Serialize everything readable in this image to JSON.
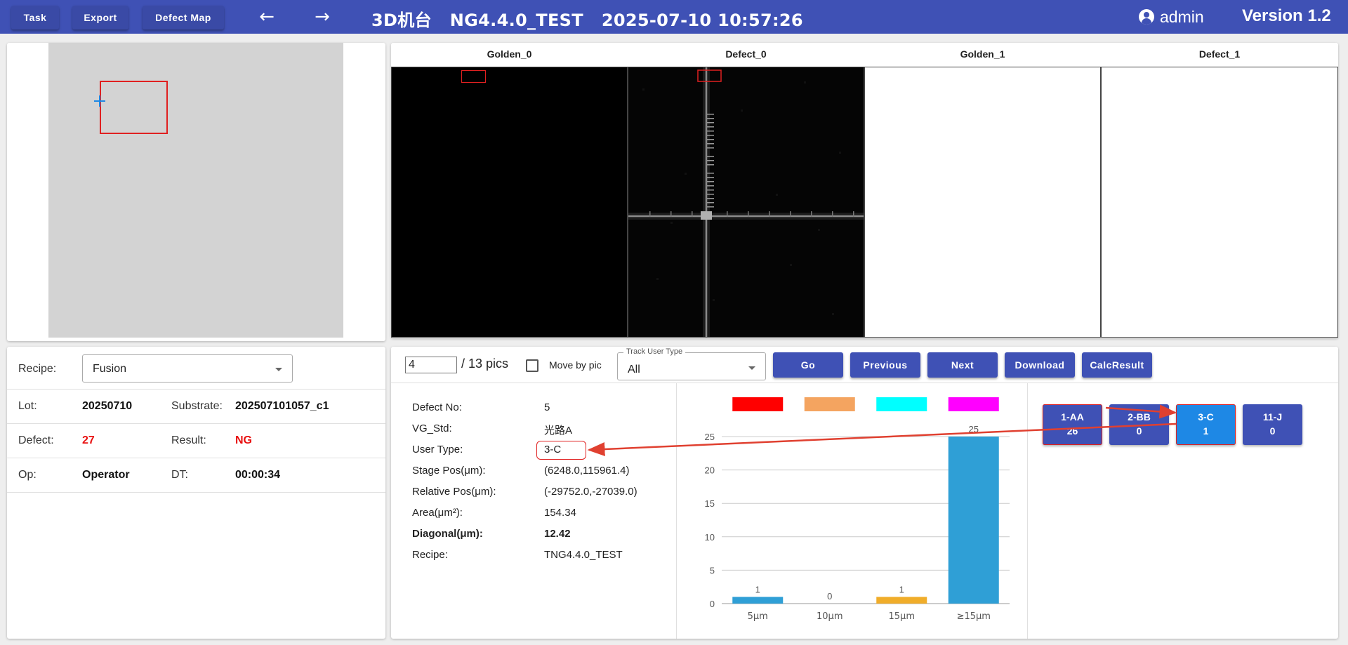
{
  "header": {
    "task_label": "Task",
    "export_label": "Export",
    "defect_map_label": "Defect Map",
    "back_icon": "arrow-left-icon",
    "forward_icon": "arrow-right-icon",
    "title": "3D机台   NG4.4.0_TEST   2025-07-10 10:57:26",
    "user": "admin",
    "version": "Version 1.2",
    "bar_color": "#3f51b5"
  },
  "images": {
    "headers": [
      "Golden_0",
      "Defect_0",
      "Golden_1",
      "Defect_1"
    ]
  },
  "info": {
    "recipe_label": "Recipe:",
    "recipe_value": "Fusion",
    "lot_label": "Lot:",
    "lot_value": "20250710",
    "substrate_label": "Substrate:",
    "substrate_value": "202507101057_c1",
    "defect_label": "Defect:",
    "defect_value": "27",
    "result_label": "Result:",
    "result_value": "NG",
    "op_label": "Op:",
    "op_value": "Operator",
    "dt_label": "DT:",
    "dt_value": "00:00:34"
  },
  "toolbar": {
    "page_value": "4",
    "page_total": "/ 13 pics",
    "move_by_pic_label": "Move by pic",
    "move_by_pic_checked": false,
    "track_user_type_label": "Track User Type",
    "track_user_type_value": "All",
    "go_label": "Go",
    "previous_label": "Previous",
    "next_label": "Next",
    "download_label": "Download",
    "calc_result_label": "CalcResult"
  },
  "details": {
    "defect_no_label": "Defect No:",
    "defect_no_value": "5",
    "vg_std_label": "VG_Std:",
    "vg_std_value": "光路A",
    "user_type_label": "User Type:",
    "user_type_value": "3-C",
    "stage_pos_label": "Stage Pos(μm):",
    "stage_pos_value": "(6248.0,115961.4)",
    "relative_pos_label": "Relative Pos(μm):",
    "relative_pos_value": "(-29752.0,-27039.0)",
    "area_label": "Area(μm²):",
    "area_value": "154.34",
    "diagonal_label": "Diagonal(μm):",
    "diagonal_value": "12.42",
    "recipe_label": "Recipe:",
    "recipe_value": "TNG4.4.0_TEST"
  },
  "chart_data": {
    "type": "bar",
    "categories": [
      "5μm",
      "10μm",
      "15μm",
      "≥15μm"
    ],
    "values": [
      1,
      0,
      1,
      25
    ],
    "bar_colors": [
      "#2f9fd6",
      "#2f9fd6",
      "#f0ad2a",
      "#2f9fd6"
    ],
    "legend_swatches": [
      "#ff0000",
      "#f4a460",
      "#00ffff",
      "#ff00ff"
    ],
    "ylim": [
      0,
      25
    ],
    "yticks": [
      0,
      5,
      10,
      15,
      20,
      25
    ],
    "grid": true,
    "title": "",
    "xlabel": "",
    "ylabel": ""
  },
  "user_types": [
    {
      "name": "1-AA",
      "count": "26",
      "active": false,
      "highlighted": true
    },
    {
      "name": "2-BB",
      "count": "0",
      "active": false,
      "highlighted": false
    },
    {
      "name": "3-C",
      "count": "1",
      "active": true,
      "highlighted": true
    },
    {
      "name": "11-J",
      "count": "0",
      "active": false,
      "highlighted": false
    }
  ]
}
